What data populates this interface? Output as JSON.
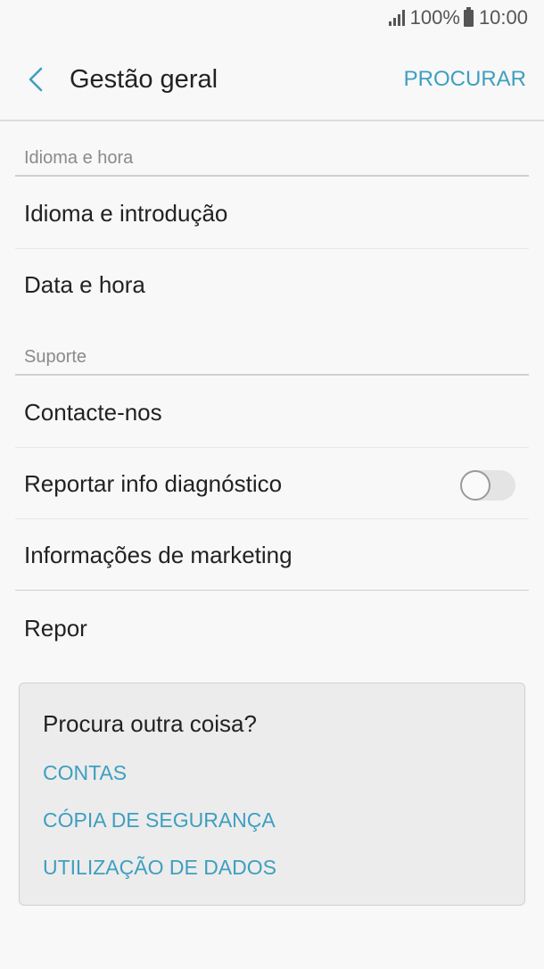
{
  "status_bar": {
    "battery": "100%",
    "time": "10:00",
    "icons": [
      "signal-icon",
      "battery-icon"
    ]
  },
  "header": {
    "title": "Gestão geral",
    "search_label": "PROCURAR",
    "back_icon": "chevron-left-icon"
  },
  "sections": {
    "language_time": {
      "title": "Idioma e hora",
      "items": [
        {
          "label": "Idioma e introdução"
        },
        {
          "label": "Data e hora"
        }
      ]
    },
    "support": {
      "title": "Suporte",
      "items": [
        {
          "label": "Contacte-nos"
        },
        {
          "label": "Reportar info diagnóstico",
          "toggle": false
        },
        {
          "label": "Informações de marketing"
        },
        {
          "label": "Repor"
        }
      ]
    }
  },
  "suggestions": {
    "title": "Procura outra coisa?",
    "links": [
      "CONTAS",
      "CÓPIA DE SEGURANÇA",
      "UTILIZAÇÃO DE DADOS"
    ]
  },
  "colors": {
    "accent": "#3e9fc0",
    "background": "#f8f8f8",
    "text": "#222222",
    "secondary_text": "#8a8a8a"
  }
}
